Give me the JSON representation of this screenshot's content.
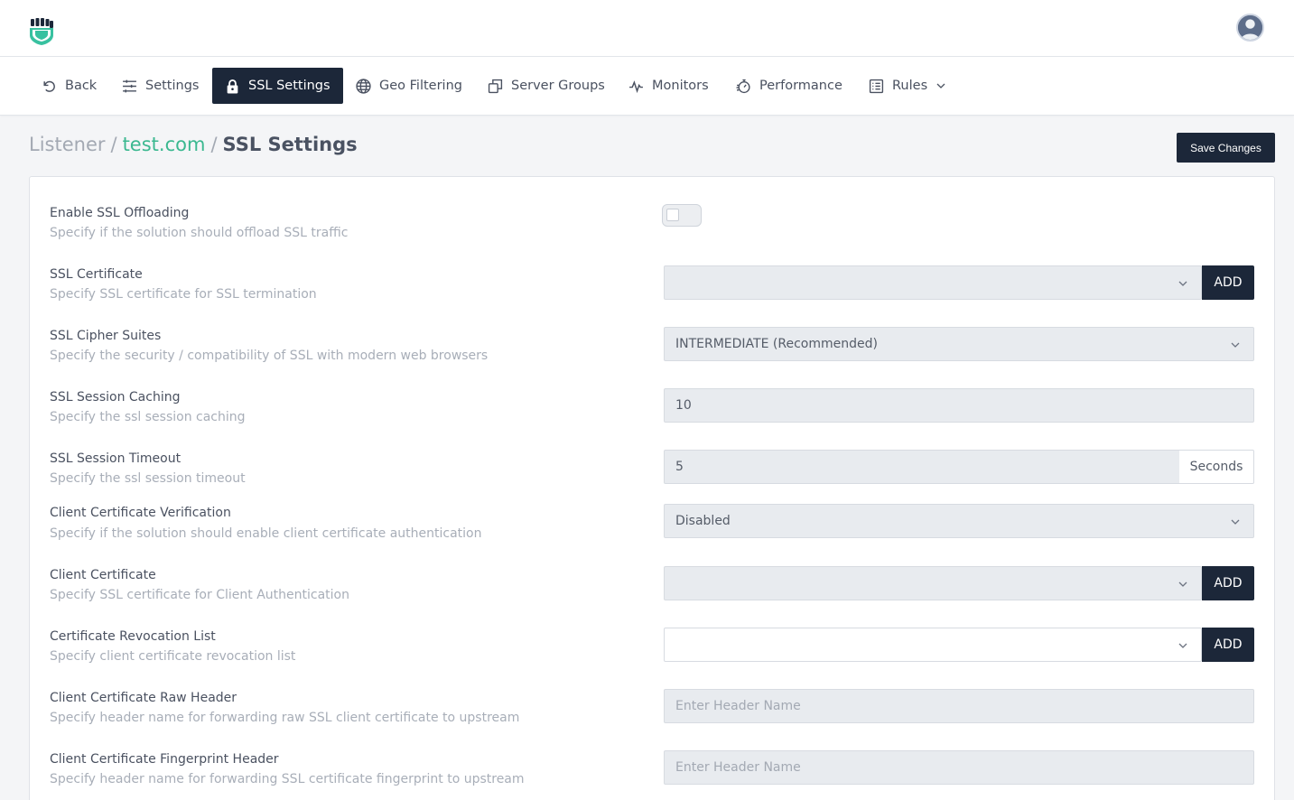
{
  "header": {
    "logo_icon": "fist-shield-logo",
    "avatar_icon": "user-avatar"
  },
  "nav": {
    "items": [
      {
        "label": "Back",
        "icon": "undo-icon"
      },
      {
        "label": "Settings",
        "icon": "sliders-icon"
      },
      {
        "label": "SSL Settings",
        "icon": "lock-icon",
        "active": true
      },
      {
        "label": "Geo Filtering",
        "icon": "globe-icon"
      },
      {
        "label": "Server Groups",
        "icon": "copy-icon"
      },
      {
        "label": "Monitors",
        "icon": "pulse-icon"
      },
      {
        "label": "Performance",
        "icon": "stopwatch-icon"
      },
      {
        "label": "Rules",
        "icon": "list-icon",
        "dropdown": true
      }
    ]
  },
  "breadcrumb": {
    "root": "Listener",
    "sep": "/",
    "link": "test.com",
    "current": "SSL Settings"
  },
  "actions": {
    "save_label": "Save Changes"
  },
  "form": {
    "fields": [
      {
        "label": "Enable SSL Offloading",
        "desc": "Specify if the solution should offload SSL traffic",
        "type": "toggle",
        "value": false
      },
      {
        "label": "SSL Certificate",
        "desc": "Specify SSL certificate for SSL termination",
        "type": "select-add",
        "value": "",
        "add_label": "ADD"
      },
      {
        "label": "SSL Cipher Suites",
        "desc": "Specify the security / compatibility of SSL with modern web browsers",
        "type": "select",
        "value": "INTERMEDIATE (Recommended)"
      },
      {
        "label": "SSL Session Caching",
        "desc": "Specify the ssl session caching",
        "type": "text",
        "value": "10"
      },
      {
        "label": "SSL Session Timeout",
        "desc": "Specify the ssl session timeout",
        "type": "text-addon",
        "value": "5",
        "addon": "Seconds"
      },
      {
        "label": "Client Certificate Verification",
        "desc": "Specify if the solution should enable client certificate authentication",
        "type": "select",
        "value": "Disabled"
      },
      {
        "label": "Client Certificate",
        "desc": "Specify SSL certificate for Client Authentication",
        "type": "select-add",
        "value": "",
        "add_label": "ADD"
      },
      {
        "label": "Certificate Revocation List",
        "desc": "Specify client certificate revocation list",
        "type": "select-add",
        "value": "",
        "add_label": "ADD"
      },
      {
        "label": "Client Certificate Raw Header",
        "desc": "Specify header name for forwarding raw SSL client certificate to upstream",
        "type": "text",
        "value": "",
        "placeholder": "Enter Header Name"
      },
      {
        "label": "Client Certificate Fingerprint Header",
        "desc": "Specify header name for forwarding SSL certificate fingerprint to upstream",
        "type": "text",
        "value": "",
        "placeholder": "Enter Header Name"
      }
    ]
  },
  "colors": {
    "primary_dark": "#1c2739",
    "link_green": "#3bb890",
    "input_bg": "#e8ebef"
  }
}
